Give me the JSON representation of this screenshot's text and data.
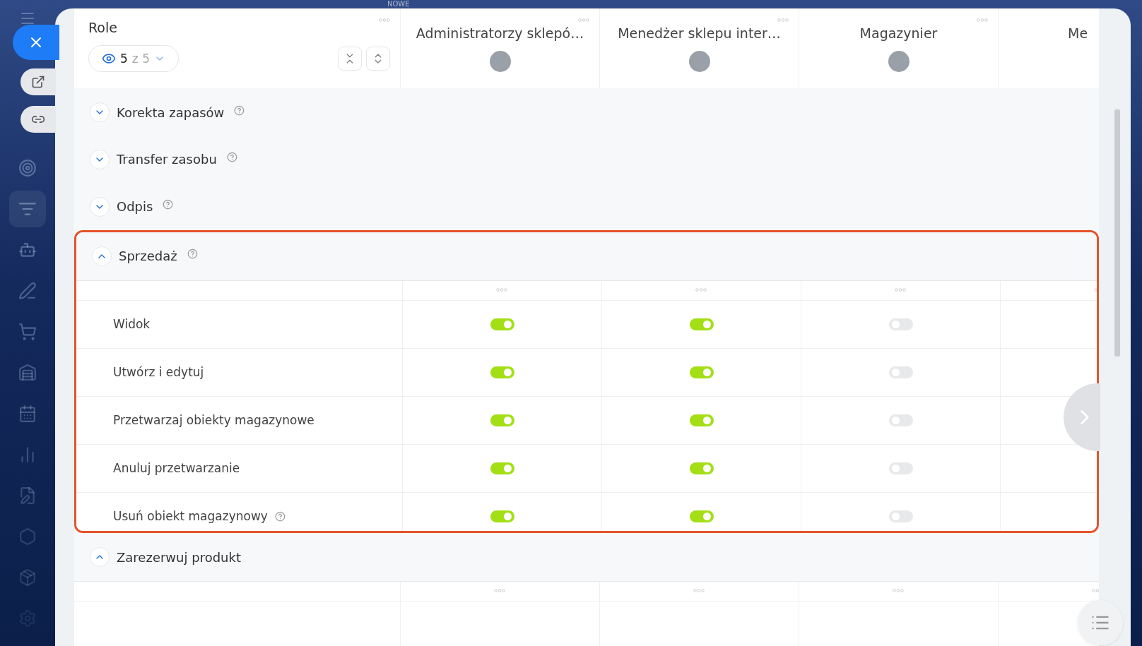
{
  "top_label": "NOWE",
  "header": {
    "title": "Role",
    "visible": {
      "shown": "5",
      "of": "z 5"
    }
  },
  "roles": [
    {
      "name": "Administratorzy sklepó…",
      "avatar": true
    },
    {
      "name": "Menedżer sklepu inter…",
      "avatar": true
    },
    {
      "name": "Magazynier",
      "avatar": true
    },
    {
      "name": "Me"
    }
  ],
  "sections": [
    {
      "title": "Korekta zapasów",
      "expanded": false,
      "highlighted": false,
      "help": true
    },
    {
      "title": "Transfer zasobu",
      "expanded": false,
      "highlighted": false,
      "help": true
    },
    {
      "title": "Odpis",
      "expanded": false,
      "highlighted": false,
      "help": true
    },
    {
      "title": "Sprzedaż",
      "expanded": true,
      "highlighted": true,
      "help": true,
      "permissions": [
        {
          "label": "Widok",
          "toggles": [
            {
              "on": true
            },
            {
              "on": true
            },
            {
              "on": false
            }
          ]
        },
        {
          "label": "Utwórz i edytuj",
          "toggles": [
            {
              "on": true
            },
            {
              "on": true
            },
            {
              "on": false
            }
          ]
        },
        {
          "label": "Przetwarzaj obiekty magazynowe",
          "toggles": [
            {
              "on": true
            },
            {
              "on": true
            },
            {
              "on": false
            }
          ]
        },
        {
          "label": "Anuluj przetwarzanie",
          "toggles": [
            {
              "on": true
            },
            {
              "on": true
            },
            {
              "on": false
            }
          ]
        },
        {
          "label": "Usuń obiekt magazynowy",
          "help": true,
          "toggles": [
            {
              "on": true
            },
            {
              "on": true
            },
            {
              "on": false
            }
          ]
        }
      ]
    },
    {
      "title": "Zarezerwuj produkt",
      "expanded": true,
      "highlighted": false
    }
  ]
}
